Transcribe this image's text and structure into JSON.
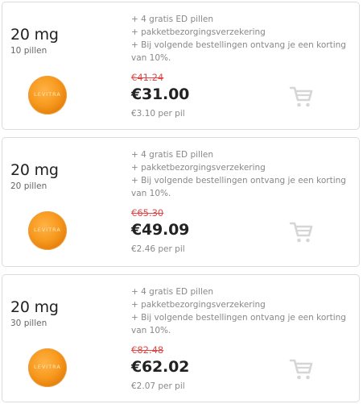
{
  "products": [
    {
      "dose": "20 mg",
      "pills": "10 pillen",
      "pill_brand": "LEVITRA",
      "perks": [
        "+ 4 gratis ED pillen",
        "+ pakketbezorgingsverzekering",
        "+ Bij volgende bestellingen ontvang je een korting van 10%."
      ],
      "old_price": "€41.24",
      "price": "€31.00",
      "per_pill": "€3.10 per pil",
      "cart_icon": "cart-icon"
    },
    {
      "dose": "20 mg",
      "pills": "20 pillen",
      "pill_brand": "LEVITRA",
      "perks": [
        "+ 4 gratis ED pillen",
        "+ pakketbezorgingsverzekering",
        "+ Bij volgende bestellingen ontvang je een korting van 10%."
      ],
      "old_price": "€65.30",
      "price": "€49.09",
      "per_pill": "€2.46 per pil",
      "cart_icon": "cart-icon"
    },
    {
      "dose": "20 mg",
      "pills": "30 pillen",
      "pill_brand": "LEVITRA",
      "perks": [
        "+ 4 gratis ED pillen",
        "+ pakketbezorgingsverzekering",
        "+ Bij volgende bestellingen ontvang je een korting van 10%."
      ],
      "old_price": "€82.48",
      "price": "€62.02",
      "per_pill": "€2.07 per pil",
      "cart_icon": "cart-icon"
    }
  ],
  "colors": {
    "old_price": "#e04848",
    "pill": "#f79a1e",
    "cart": "#d6d6d6",
    "border": "#dcdcdc"
  }
}
